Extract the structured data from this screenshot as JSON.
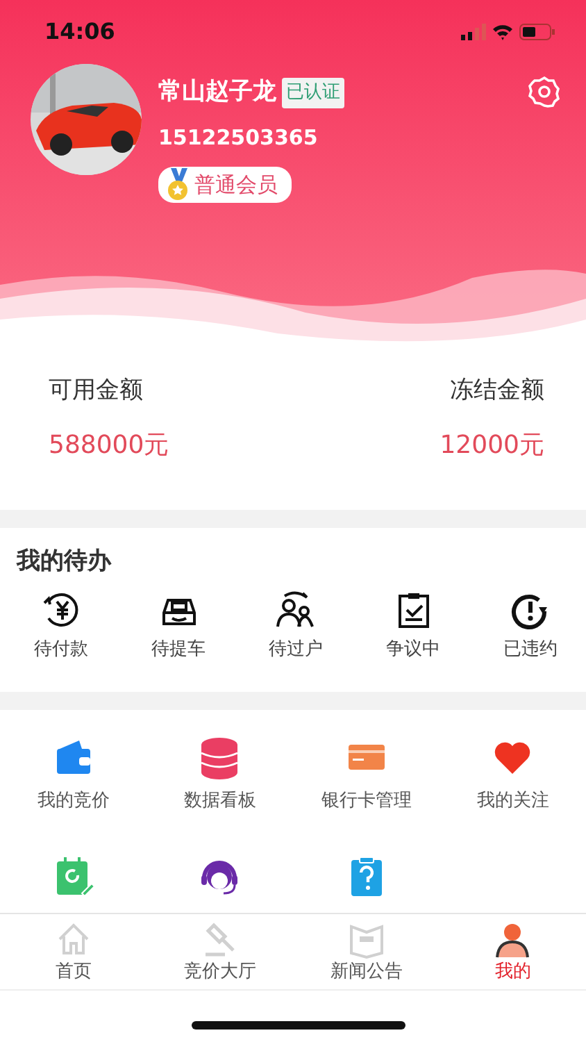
{
  "status_bar": {
    "time": "14:06"
  },
  "profile": {
    "name": "常山赵子龙",
    "verified_badge": "已认证",
    "phone": "15122503365",
    "membership": "普通会员"
  },
  "balances": [
    {
      "label": "可用金额",
      "amount": "588000元"
    },
    {
      "label": "冻结金额",
      "amount": "12000元"
    }
  ],
  "todo": {
    "title": "我的待办",
    "items": [
      {
        "label": "待付款"
      },
      {
        "label": "待提车"
      },
      {
        "label": "待过户"
      },
      {
        "label": "争议中"
      },
      {
        "label": "已违约"
      }
    ]
  },
  "menu_grid": [
    {
      "kind": "labeled",
      "label": "我的竞价"
    },
    {
      "kind": "labeled",
      "label": "数据看板"
    },
    {
      "kind": "labeled",
      "label": "银行卡管理"
    },
    {
      "kind": "labeled",
      "label": "我的关注"
    },
    {
      "kind": "icon"
    },
    {
      "kind": "icon"
    },
    {
      "kind": "icon"
    }
  ],
  "tab_bar": [
    {
      "label": "首页",
      "selected": false
    },
    {
      "label": "竞价大厅",
      "selected": false
    },
    {
      "label": "新闻公告",
      "selected": false
    },
    {
      "label": "我的",
      "selected": true
    }
  ]
}
